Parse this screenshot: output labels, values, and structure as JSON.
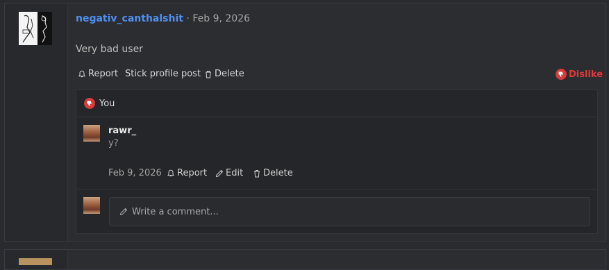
{
  "post": {
    "username": "negativ_canthalshit",
    "separator": " · ",
    "date": "Feb 9, 2026",
    "body": "Very bad user",
    "actions": {
      "report": "Report",
      "stick": "Stick profile post",
      "delete": "Delete",
      "dislike": "Dislike"
    }
  },
  "reactions": {
    "reactor": "You"
  },
  "comment": {
    "username": "rawr_",
    "text": "y?",
    "date": "Feb 9, 2026",
    "actions": {
      "report": "Report",
      "edit": "Edit",
      "delete": "Delete"
    }
  },
  "write_comment": {
    "placeholder": "Write a comment..."
  },
  "colors": {
    "username": "#4f8ff0",
    "dislike": "#e0383a",
    "background": "#2a2b2f"
  }
}
